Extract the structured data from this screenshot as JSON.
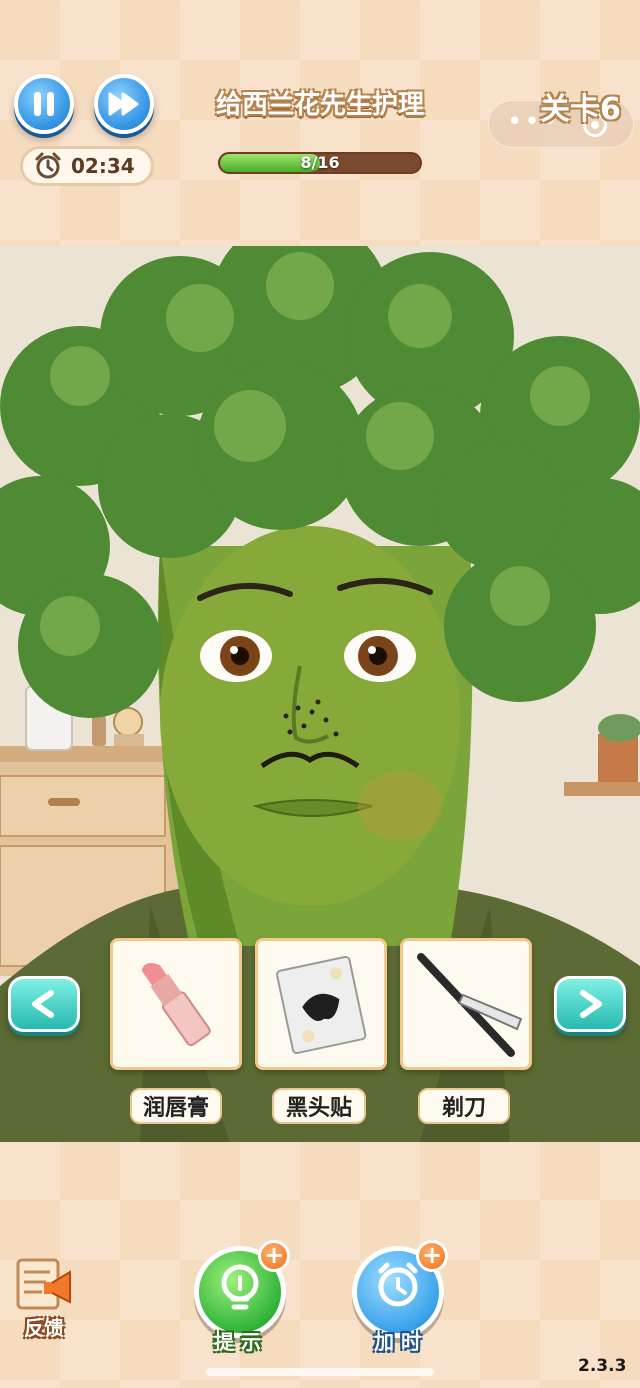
{
  "header": {
    "title": "给西兰花先生护理",
    "level": "关卡6",
    "timer": "02:34",
    "progress_text": "8/16",
    "progress_fraction": 0.5,
    "capsule_dots": "•••"
  },
  "tools": [
    {
      "label": "润唇膏",
      "icon": "lipstick-icon"
    },
    {
      "label": "黑头贴",
      "icon": "nose-strip-icon"
    },
    {
      "label": "剃刀",
      "icon": "razor-icon"
    }
  ],
  "nav": {
    "prev_icon": "chevron-left-icon",
    "next_icon": "chevron-right-icon"
  },
  "bottom": {
    "feedback_label": "反馈",
    "hint_label": "提 示",
    "add_time_label": "加 时",
    "plus_symbol": "+",
    "version": "2.3.3"
  },
  "colors": {
    "background": "#f6dcbf",
    "accent_blue": "#3a9be6",
    "accent_green": "#33b43a",
    "accent_teal": "#27b9b0",
    "accent_orange": "#f0701e"
  }
}
